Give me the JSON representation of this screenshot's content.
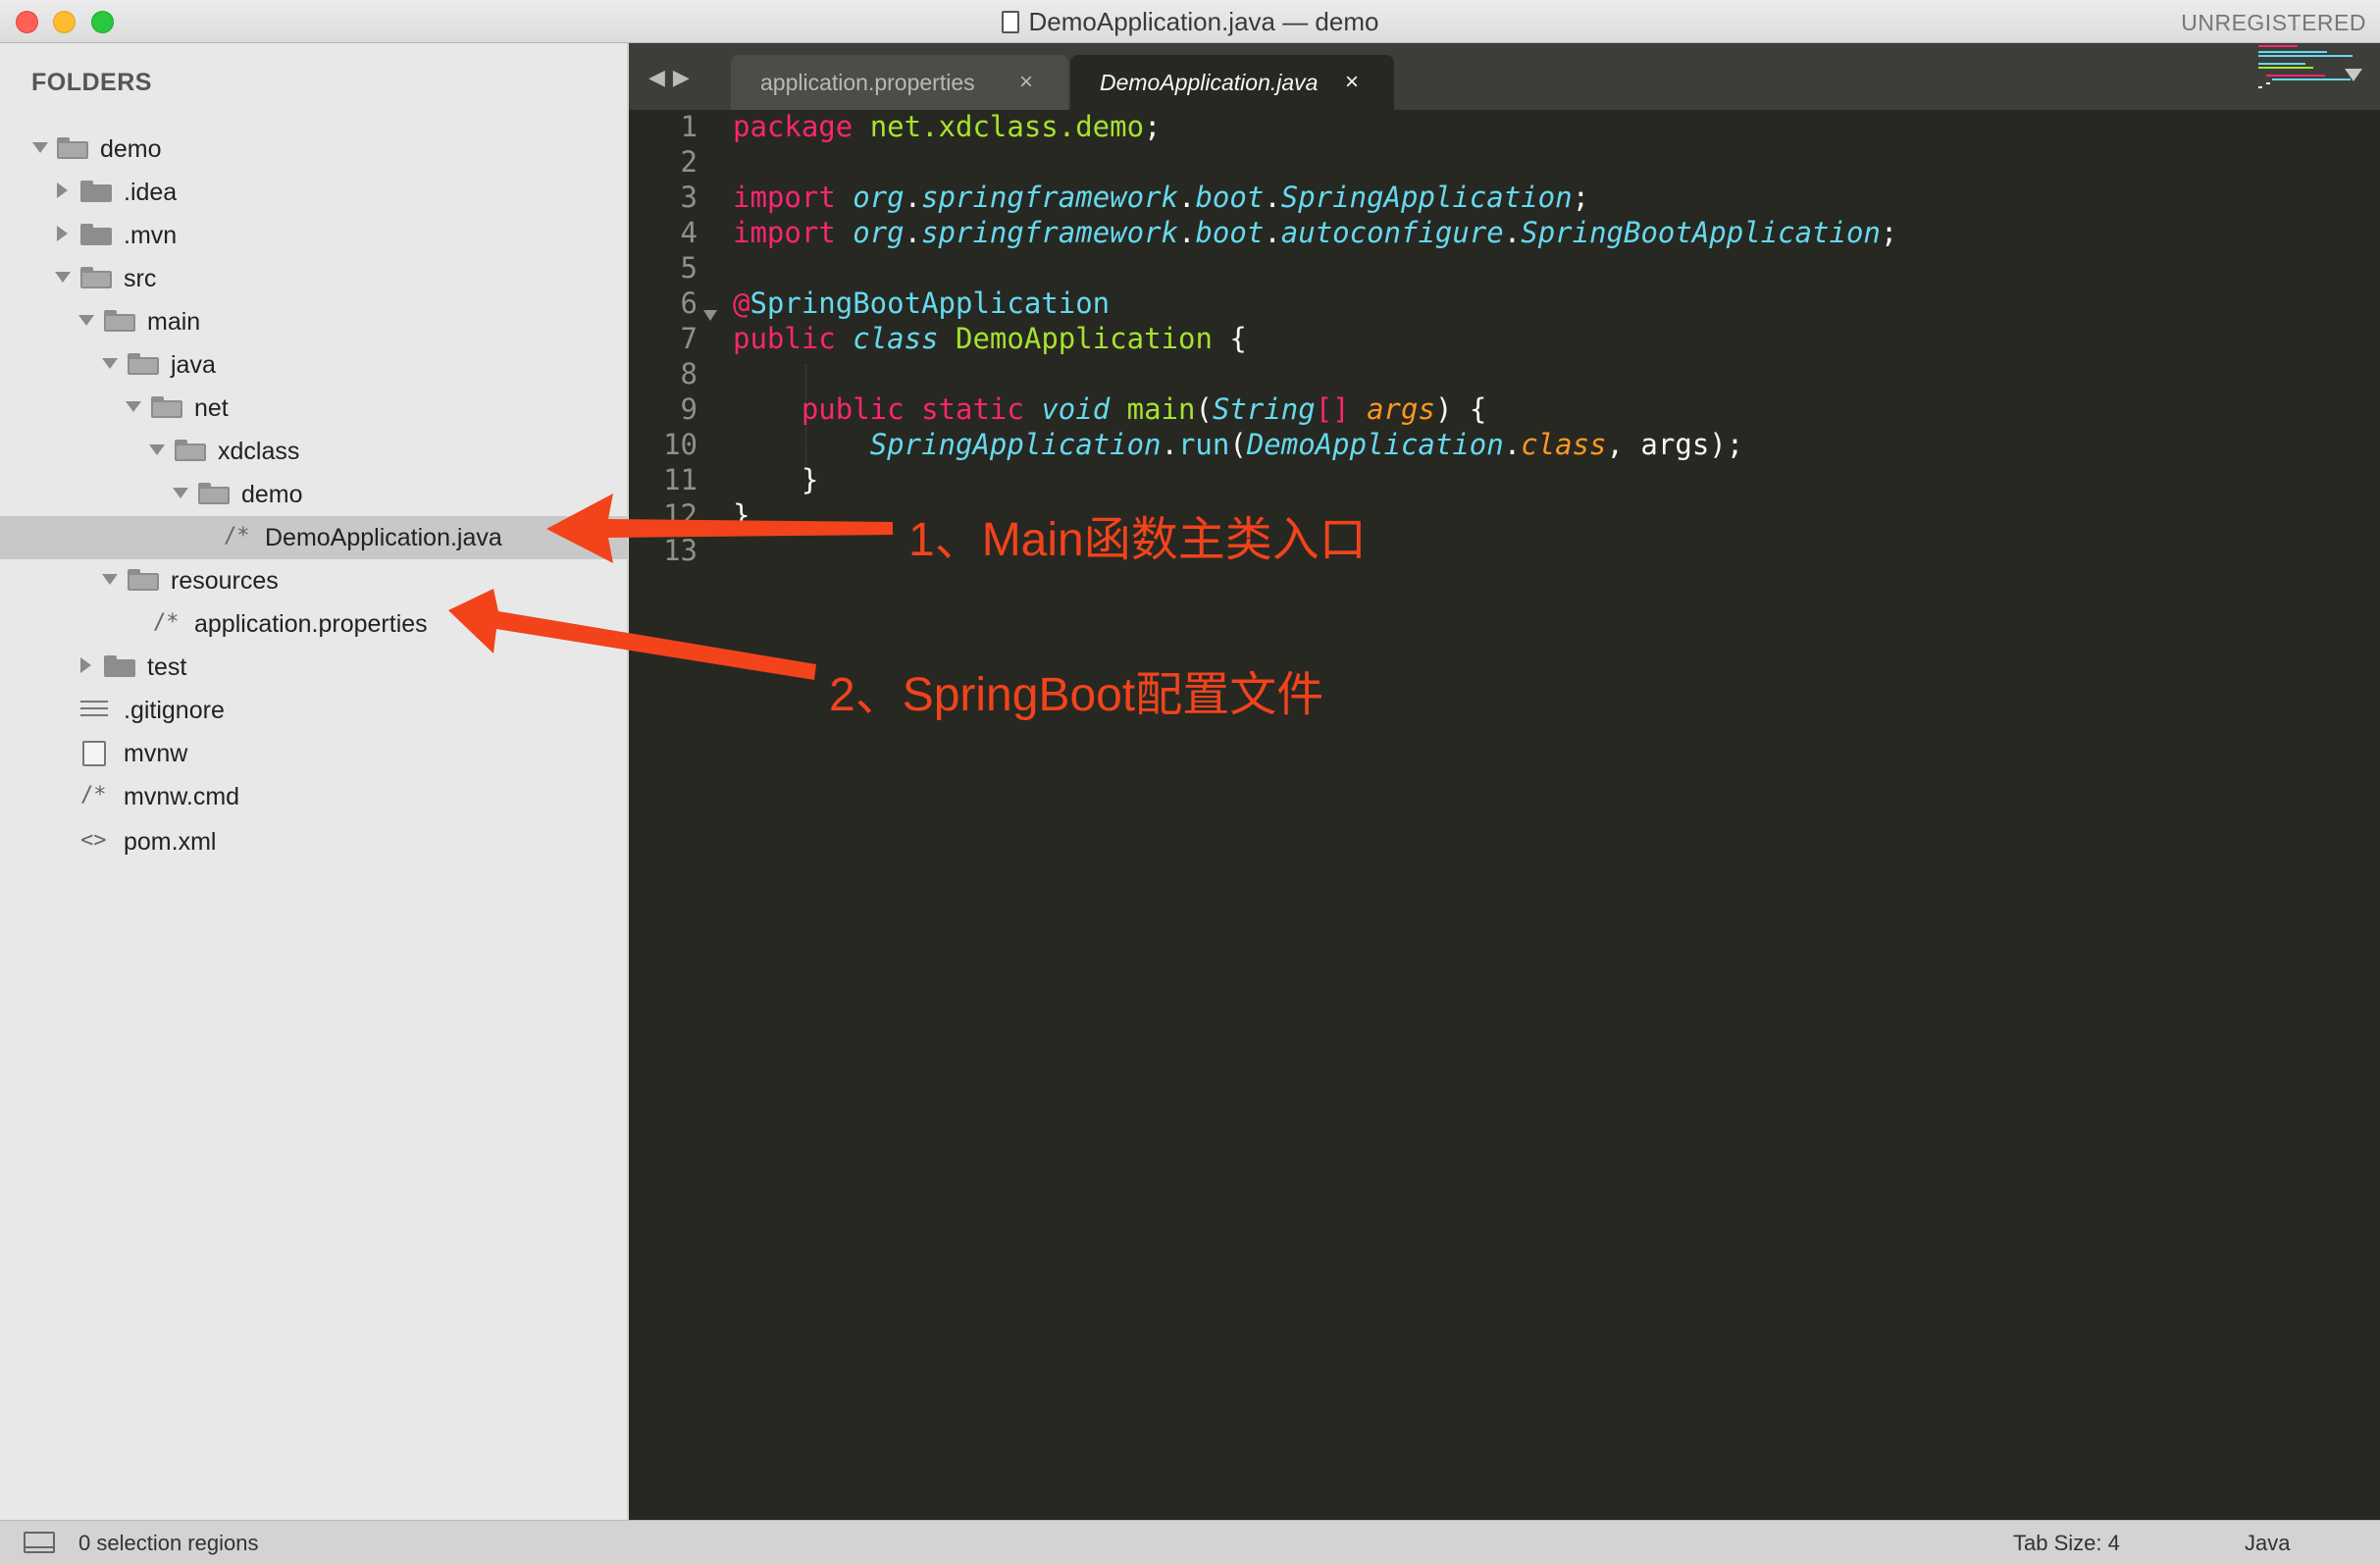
{
  "window": {
    "title": "DemoApplication.java — demo",
    "registration": "UNREGISTERED"
  },
  "sidebar": {
    "header": "FOLDERS",
    "items": [
      {
        "label": "demo",
        "icon": "folder-open-icon",
        "expanded": true
      },
      {
        "label": ".idea",
        "icon": "folder-icon",
        "expanded": false
      },
      {
        "label": ".mvn",
        "icon": "folder-icon",
        "expanded": false
      },
      {
        "label": "src",
        "icon": "folder-open-icon",
        "expanded": true
      },
      {
        "label": "main",
        "icon": "folder-open-icon",
        "expanded": true
      },
      {
        "label": "java",
        "icon": "folder-open-icon",
        "expanded": true
      },
      {
        "label": "net",
        "icon": "folder-open-icon",
        "expanded": true
      },
      {
        "label": "xdclass",
        "icon": "folder-open-icon",
        "expanded": true
      },
      {
        "label": "demo",
        "icon": "folder-open-icon",
        "expanded": true
      },
      {
        "label": "DemoApplication.java",
        "icon": "comment-file-icon",
        "glyph": "/*",
        "selected": true
      },
      {
        "label": "resources",
        "icon": "folder-open-icon",
        "expanded": true
      },
      {
        "label": "application.properties",
        "icon": "comment-file-icon",
        "glyph": "/*"
      },
      {
        "label": "test",
        "icon": "folder-icon",
        "expanded": false
      },
      {
        "label": ".gitignore",
        "icon": "lines-file-icon"
      },
      {
        "label": "mvnw",
        "icon": "plain-file-icon"
      },
      {
        "label": "mvnw.cmd",
        "icon": "comment-file-icon",
        "glyph": "/*"
      },
      {
        "label": "pom.xml",
        "icon": "markup-file-icon",
        "glyph": "<>"
      }
    ]
  },
  "tabs": [
    {
      "label": "application.properties",
      "active": false,
      "close": "×"
    },
    {
      "label": "DemoApplication.java",
      "active": true,
      "close": "×"
    }
  ],
  "editor": {
    "line_numbers": [
      "1",
      "2",
      "3",
      "4",
      "5",
      "6",
      "7",
      "8",
      "9",
      "10",
      "11",
      "12",
      "13"
    ],
    "code": {
      "l1_kw": "package",
      "l1_pkg": "net.xdclass.demo",
      "l1_end": ";",
      "l3_kw": "import",
      "l3_a": "org",
      "l3_b": "springframework",
      "l3_c": "boot",
      "l3_d": "SpringApplication",
      "l4_kw": "import",
      "l4_a": "org",
      "l4_b": "springframework",
      "l4_c": "boot",
      "l4_d": "autoconfigure",
      "l4_e": "SpringBootApplication",
      "l6_at": "@",
      "l6_ann": "SpringBootApplication",
      "l7_kw": "public",
      "l7_class": "class",
      "l7_name": "DemoApplication",
      "l7_brace": "{",
      "l9_public": "public",
      "l9_static": "static",
      "l9_void": "void",
      "l9_main": "main",
      "l9_type": "String",
      "l9_arr": "[]",
      "l9_args": "args",
      "l9_end": ") {",
      "l10_cls": "SpringApplication",
      "l10_run": "run",
      "l10_arg": "DemoApplication",
      "l10_class": "class",
      "l10_end": ", args);",
      "l11": "}",
      "l12": "}"
    }
  },
  "annotations": [
    {
      "text": "1、Main函数主类入口",
      "color": "#f2431b"
    },
    {
      "text": "2、SpringBoot配置文件",
      "color": "#f2431b"
    }
  ],
  "status": {
    "selection": "0 selection regions",
    "tab_size": "Tab Size: 4",
    "syntax": "Java"
  },
  "colors": {
    "keyword": "#f92672",
    "function": "#a6e22e",
    "type": "#66d9ef",
    "param": "#fd971f",
    "background": "#272822",
    "annotation": "#f2431b"
  }
}
